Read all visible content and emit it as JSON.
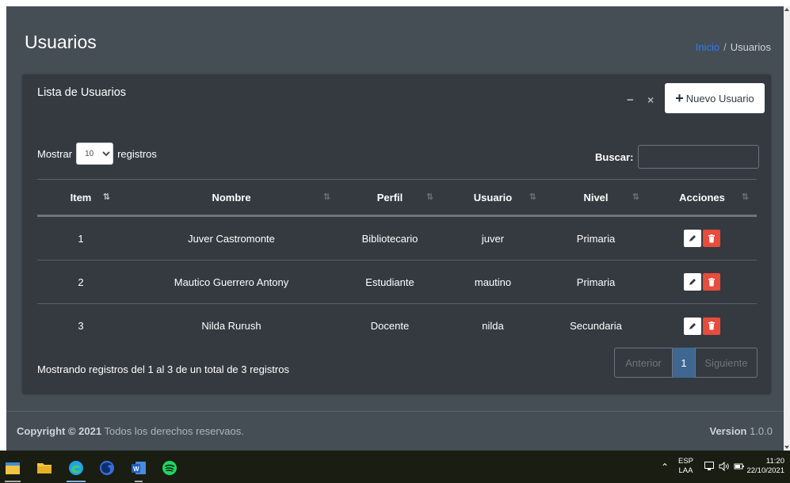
{
  "page": {
    "title": "Usuarios",
    "breadcrumb": {
      "home": "Inicio",
      "separator": "/",
      "current": "Usuarios"
    }
  },
  "card": {
    "title": "Lista de Usuarios",
    "minimize_symbol": "−",
    "close_symbol": "×",
    "new_button": {
      "icon": "plus-icon",
      "label": "Nuevo Usuario"
    }
  },
  "length_menu": {
    "prefix": "Mostrar",
    "value": "10",
    "suffix": "registros"
  },
  "search": {
    "label": "Buscar:",
    "value": "",
    "placeholder": ""
  },
  "table": {
    "columns": [
      "Item",
      "Nombre",
      "Perfil",
      "Usuario",
      "Nivel",
      "Acciones"
    ],
    "rows": [
      {
        "item": "1",
        "nombre": "Juver Castromonte",
        "perfil": "Bibliotecario",
        "usuario": "juver",
        "nivel": "Primaria"
      },
      {
        "item": "2",
        "nombre": "Mautico Guerrero Antony",
        "perfil": "Estudiante",
        "usuario": "mautino",
        "nivel": "Primaria"
      },
      {
        "item": "3",
        "nombre": "Nilda Rurush",
        "perfil": "Docente",
        "usuario": "nilda",
        "nivel": "Secundaria"
      }
    ]
  },
  "info": "Mostrando registros del 1 al 3 de un total de 3 registros",
  "pagination": {
    "prev": "Anterior",
    "current": "1",
    "next": "Siguiente"
  },
  "footer": {
    "copyright_bold": "Copyright © 2021",
    "copyright_rest": "Todos los derechos reservaos.",
    "version_label": "Version",
    "version_value": "1.0.0"
  },
  "taskbar": {
    "apps": [
      "file-explorer-icon",
      "folder-icon",
      "edge-icon",
      "firefox-icon",
      "word-icon",
      "spotify-icon"
    ],
    "lang_line1": "ESP",
    "lang_line2": "LAA",
    "time": "11:20",
    "date": "22/10/2021"
  },
  "colors": {
    "app_bg": "#454d55",
    "card_bg": "#343a40",
    "link": "#2f7cf6",
    "delete": "#e74c3c",
    "page_active": "#3f6791"
  }
}
